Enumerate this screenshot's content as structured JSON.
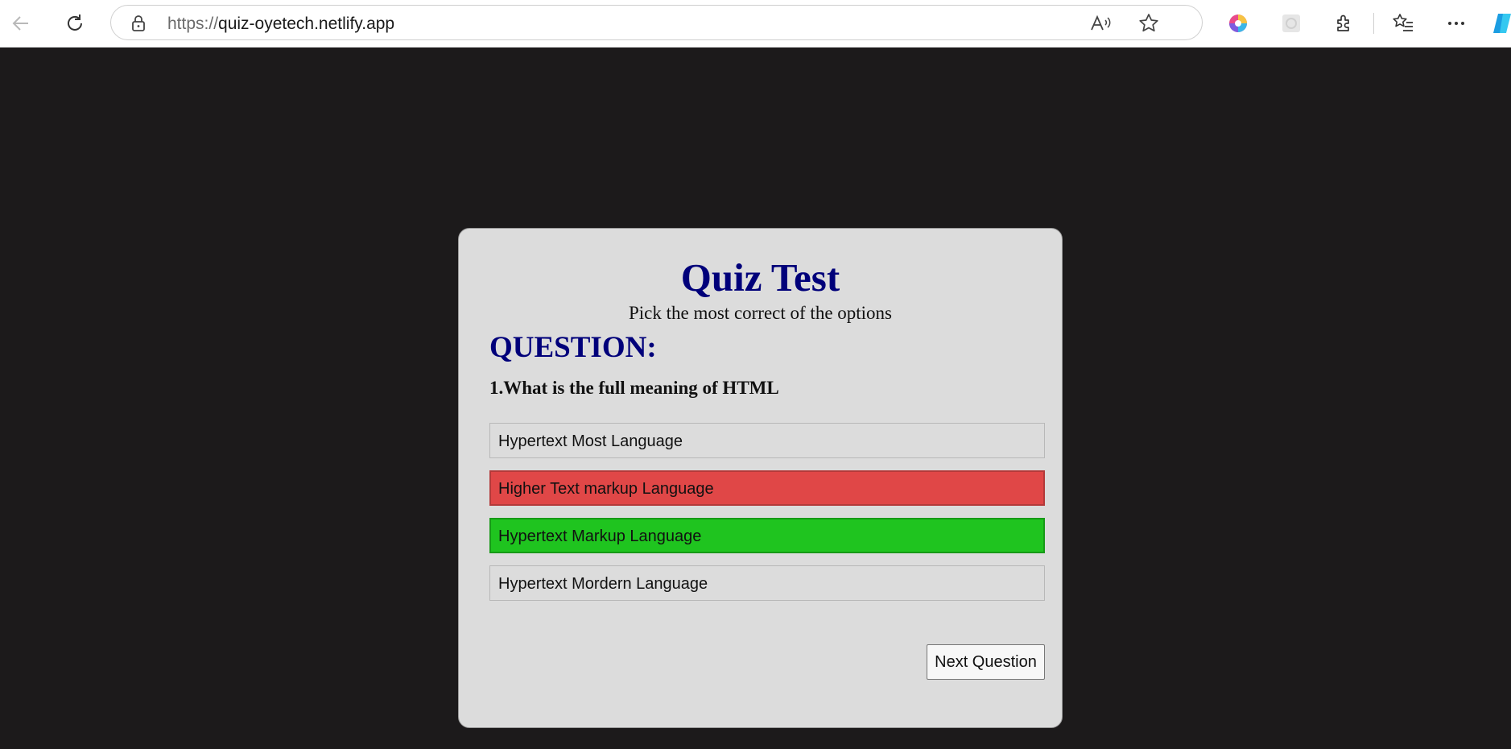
{
  "browser": {
    "url_scheme": "https://",
    "url_host": "quiz-oyetech.netlify.app",
    "icons": [
      "back-icon",
      "refresh-icon",
      "lock-icon",
      "read-aloud-icon",
      "favorite-star-icon",
      "color-wheel-icon",
      "extension-placeholder-icon",
      "puzzle-extensions-icon",
      "favorites-list-icon",
      "more-options-icon",
      "copilot-icon"
    ]
  },
  "quiz": {
    "title": "Quiz Test",
    "subtitle": "Pick the most correct of the options",
    "question_heading": "QUESTION:",
    "question_text": "1.What is the full meaning of HTML",
    "options": [
      {
        "label": "Hypertext Most Language",
        "state": "neutral"
      },
      {
        "label": "Higher Text markup Language",
        "state": "wrong"
      },
      {
        "label": "Hypertext Markup Language",
        "state": "correct"
      },
      {
        "label": "Hypertext Mordern Language",
        "state": "neutral"
      }
    ],
    "next_label": "Next Question"
  },
  "colors": {
    "page_bg": "#1c1a1b",
    "card_bg": "#dcdcdc",
    "heading": "#00007a",
    "wrong": "#e04747",
    "correct": "#1fc41f"
  }
}
